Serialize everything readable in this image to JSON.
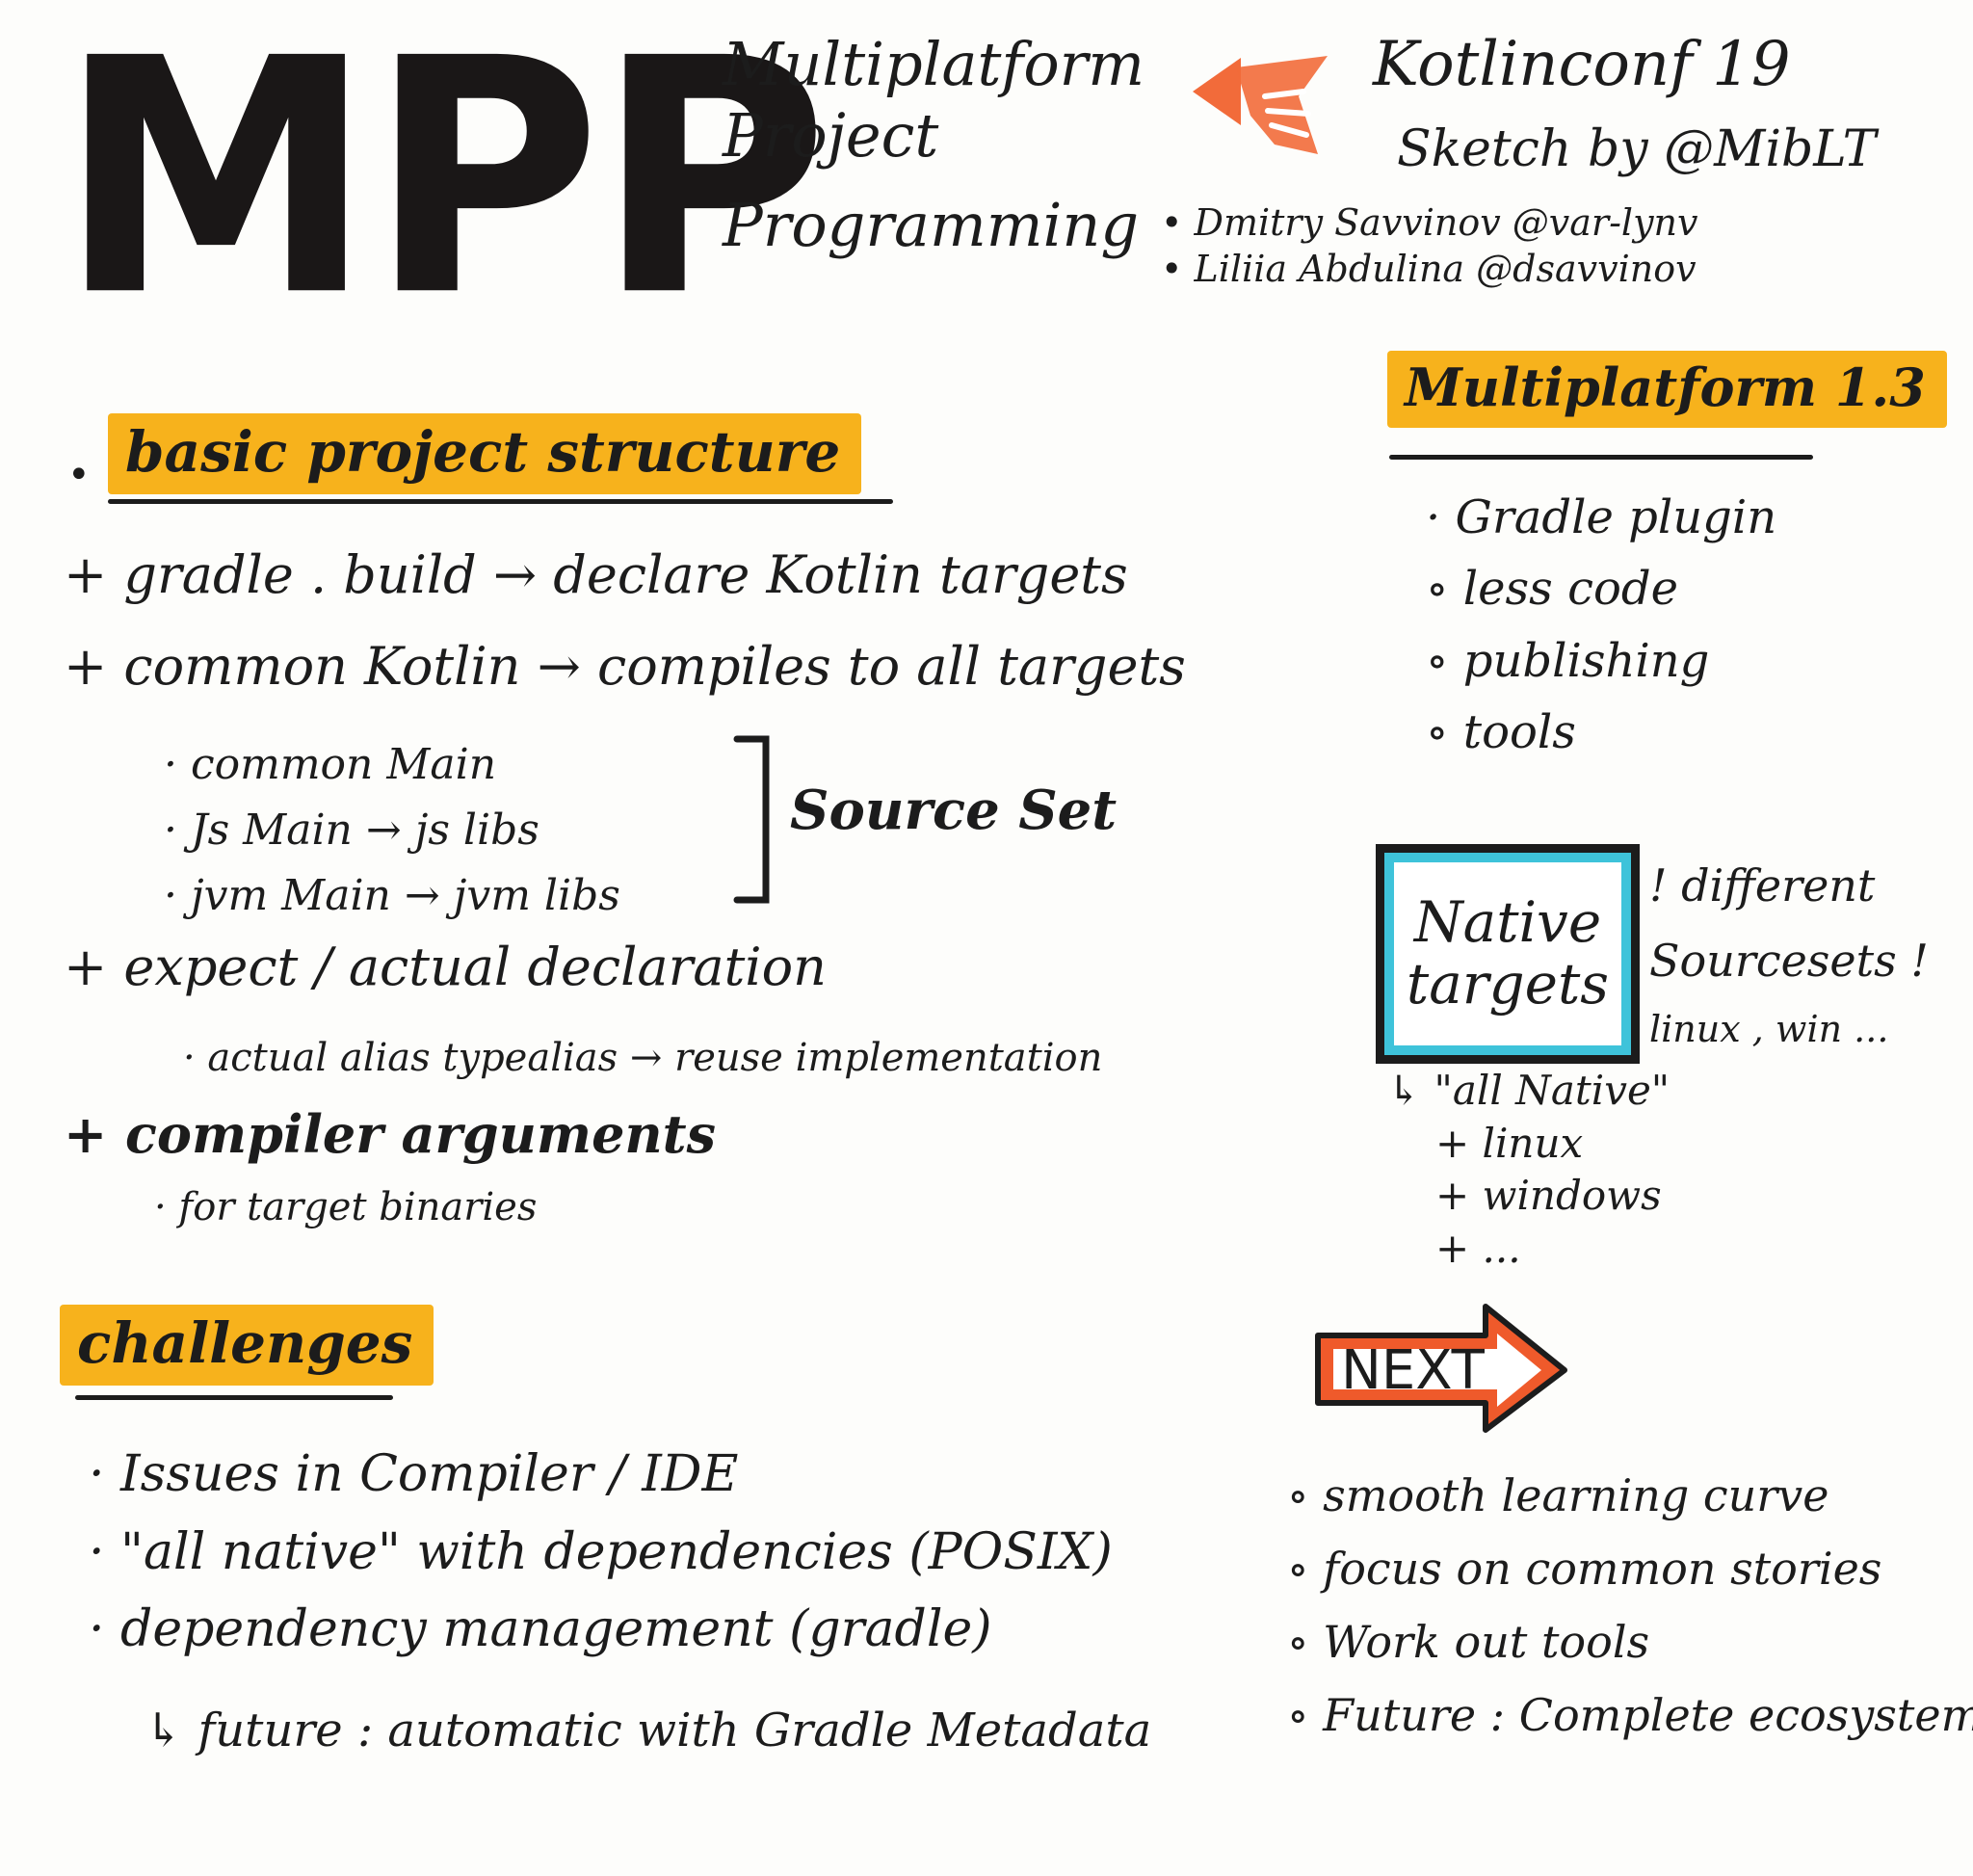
{
  "header": {
    "big_title": "MPP",
    "subtitle_lines": [
      "Multiplatform",
      "Project",
      "Programming"
    ],
    "event": "Kotlinconf 19",
    "sketch_by": "Sketch by @MibLT",
    "speakers": [
      "• Dmitry Savvinov @var-lynv",
      "• Liliia Abdulina @dsavvinov"
    ]
  },
  "left": {
    "section1_title": "basic project structure",
    "items": [
      "+ gradle . build → declare Kotlin targets",
      "+ common Kotlin → compiles to all targets"
    ],
    "sourcesets": [
      "· common Main",
      "· Js Main → js libs",
      "· jvm Main → jvm libs"
    ],
    "sourceset_label": "Source Set",
    "expect_actual": "+ expect / actual declaration",
    "typealias": "· actual alias typealias → reuse implementation",
    "compiler_args": "+ compiler arguments",
    "per_target": "· for target binaries",
    "challenges_title": "challenges",
    "challenges": [
      "· Issues in Compiler / IDE",
      "· \"all native\" with dependencies (POSIX)",
      "· dependency management (gradle)"
    ],
    "future_note": "↳ future : automatic with Gradle Metadata"
  },
  "right": {
    "mp_title": "Multiplatform 1.3",
    "mp_items": [
      "· Gradle plugin",
      "∘ less code",
      "∘ publishing",
      "∘ tools"
    ],
    "native_box": [
      "Native",
      "targets"
    ],
    "native_note": [
      "! different",
      "Sourcesets !",
      "linux , win ..."
    ],
    "native_list": [
      "↳ \"all Native\"",
      "+ linux",
      "+ windows",
      "+ ..."
    ],
    "next_label": "NEXT",
    "next_items": [
      "∘ smooth learning curve",
      "∘ focus on common stories",
      "∘ Work out tools",
      "∘ Future : Complete ecosystem"
    ]
  },
  "colors": {
    "highlight": "#f7b21c",
    "native_frame": "#3ec3da",
    "next_arrow": "#ef5a2b",
    "logo": "#f26b3a",
    "ink": "#1c1c1c"
  },
  "icons": [
    "kotlin-hand-logo",
    "next-arrow-icon"
  ]
}
